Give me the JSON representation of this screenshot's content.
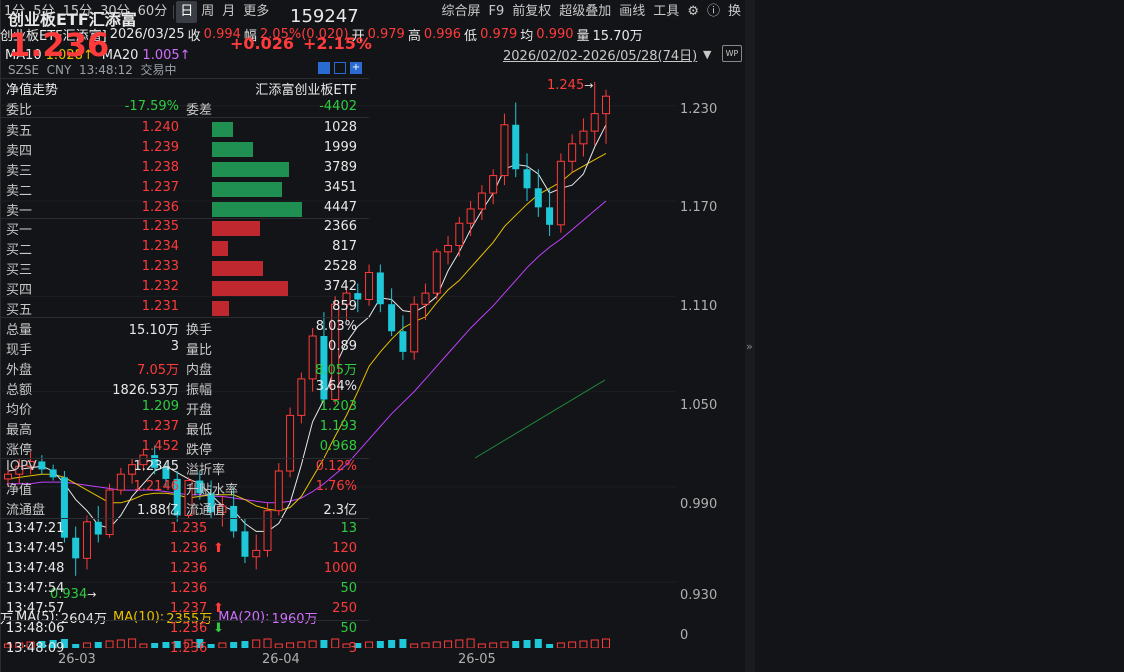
{
  "toolbar": {
    "periods": [
      "1分",
      "5分",
      "15分",
      "30分",
      "60分",
      "日",
      "周",
      "月",
      "更多"
    ],
    "active": "日",
    "tools": [
      "综合屏",
      "F9",
      "前复权",
      "超级叠加",
      "画线",
      "工具"
    ],
    "last": "换"
  },
  "info": {
    "name": "创业板ETF汇添富]",
    "date": "2026/03/25",
    "close_label": "收",
    "close": "0.994",
    "range_label": "幅",
    "range": "2.05%(0.020)",
    "open_label": "开",
    "open": "0.979",
    "high_label": "高",
    "high": "0.996",
    "low_label": "低",
    "low": "0.979",
    "avg_label": "均",
    "avg": "0.990",
    "vol_label": "量",
    "vol": "15.70万"
  },
  "ma": {
    "ma10_label": "MA10",
    "ma10": "1.028↑",
    "ma20_label": "MA20",
    "ma20": "1.005↑"
  },
  "daterange": "2026/02/02-2026/05/28(74日)",
  "axis": {
    "ticks": [
      "1.230",
      "1.170",
      "1.110",
      "1.050",
      "0.990",
      "0.930"
    ],
    "vol_tick": "0"
  },
  "annot": {
    "high": "1.245",
    "low": "0.934"
  },
  "vol_info": {
    "unit": "万",
    "ma5_label": "MA(5):",
    "ma5": "2604万",
    "ma10_label": "MA(10):",
    "ma10": "2355万",
    "ma20_label": "MA(20):",
    "ma20": "1960万"
  },
  "xlabels": [
    "26-03",
    "26-04",
    "26-05"
  ],
  "chart_data": {
    "type": "candlestick",
    "ylim": [
      0.915,
      1.255
    ],
    "candles": [
      [
        0.995,
        1.005,
        0.99,
        0.998
      ],
      [
        0.998,
        1.008,
        0.992,
        1.003
      ],
      [
        1.003,
        1.012,
        0.998,
        1.006
      ],
      [
        1.006,
        1.01,
        0.998,
        1.001
      ],
      [
        1.001,
        1.004,
        0.994,
        0.996
      ],
      [
        0.996,
        1.0,
        0.955,
        0.958
      ],
      [
        0.958,
        0.965,
        0.934,
        0.945
      ],
      [
        0.945,
        0.972,
        0.938,
        0.968
      ],
      [
        0.968,
        0.978,
        0.955,
        0.96
      ],
      [
        0.96,
        0.992,
        0.958,
        0.988
      ],
      [
        0.988,
        1.002,
        0.985,
        0.998
      ],
      [
        0.998,
        1.008,
        0.992,
        1.004
      ],
      [
        1.004,
        1.014,
        1.0,
        1.01
      ],
      [
        1.01,
        1.016,
        0.998,
        1.002
      ],
      [
        1.002,
        1.006,
        0.99,
        0.995
      ],
      [
        0.995,
        1.0,
        0.968,
        0.972
      ],
      [
        0.972,
        0.996,
        0.97,
        0.994
      ],
      [
        0.994,
        1.0,
        0.982,
        0.986
      ],
      [
        0.986,
        0.994,
        0.97,
        0.974
      ],
      [
        0.974,
        0.984,
        0.965,
        0.978
      ],
      [
        0.978,
        0.99,
        0.958,
        0.962
      ],
      [
        0.962,
        0.97,
        0.942,
        0.946
      ],
      [
        0.946,
        0.96,
        0.938,
        0.95
      ],
      [
        0.95,
        0.98,
        0.946,
        0.975
      ],
      [
        0.975,
        1.005,
        0.972,
        1.0
      ],
      [
        1.0,
        1.04,
        0.996,
        1.035
      ],
      [
        1.035,
        1.062,
        1.03,
        1.058
      ],
      [
        1.058,
        1.09,
        1.05,
        1.085
      ],
      [
        1.085,
        1.1,
        1.04,
        1.045
      ],
      [
        1.045,
        1.11,
        1.042,
        1.105
      ],
      [
        1.105,
        1.115,
        1.095,
        1.112
      ],
      [
        1.112,
        1.118,
        1.1,
        1.108
      ],
      [
        1.108,
        1.13,
        1.104,
        1.125
      ],
      [
        1.125,
        1.13,
        1.1,
        1.105
      ],
      [
        1.105,
        1.115,
        1.085,
        1.088
      ],
      [
        1.088,
        1.098,
        1.07,
        1.075
      ],
      [
        1.075,
        1.11,
        1.07,
        1.105
      ],
      [
        1.105,
        1.118,
        1.095,
        1.112
      ],
      [
        1.112,
        1.14,
        1.108,
        1.138
      ],
      [
        1.138,
        1.148,
        1.13,
        1.142
      ],
      [
        1.142,
        1.16,
        1.135,
        1.156
      ],
      [
        1.156,
        1.17,
        1.148,
        1.165
      ],
      [
        1.165,
        1.18,
        1.158,
        1.175
      ],
      [
        1.175,
        1.19,
        1.168,
        1.186
      ],
      [
        1.186,
        1.225,
        1.18,
        1.218
      ],
      [
        1.218,
        1.232,
        1.185,
        1.19
      ],
      [
        1.19,
        1.2,
        1.17,
        1.178
      ],
      [
        1.178,
        1.19,
        1.16,
        1.166
      ],
      [
        1.166,
        1.178,
        1.148,
        1.155
      ],
      [
        1.155,
        1.2,
        1.15,
        1.195
      ],
      [
        1.195,
        1.212,
        1.188,
        1.206
      ],
      [
        1.206,
        1.222,
        1.198,
        1.214
      ],
      [
        1.214,
        1.245,
        1.205,
        1.225
      ],
      [
        1.225,
        1.24,
        1.206,
        1.236
      ]
    ],
    "ma5": [
      1.0,
      1.001,
      1.002,
      1.003,
      1.0,
      0.992,
      0.982,
      0.975,
      0.966,
      0.964,
      0.972,
      0.984,
      0.992,
      1.0,
      1.003,
      0.999,
      0.995,
      0.992,
      0.985,
      0.978,
      0.975,
      0.967,
      0.962,
      0.962,
      0.967,
      0.98,
      1.004,
      1.031,
      1.045,
      1.066,
      1.081,
      1.091,
      1.097,
      1.109,
      1.108,
      1.101,
      1.1,
      1.104,
      1.11,
      1.126,
      1.138,
      1.152,
      1.164,
      1.175,
      1.19,
      1.193,
      1.192,
      1.187,
      1.175,
      1.178,
      1.18,
      1.187,
      1.204,
      1.218
    ],
    "ma10": [
      0.995,
      0.996,
      0.997,
      0.998,
      0.998,
      0.996,
      0.992,
      0.988,
      0.984,
      0.98,
      0.98,
      0.982,
      0.985,
      0.986,
      0.986,
      0.985,
      0.983,
      0.984,
      0.985,
      0.985,
      0.985,
      0.982,
      0.978,
      0.976,
      0.975,
      0.977,
      0.984,
      0.996,
      1.008,
      1.022,
      1.035,
      1.05,
      1.066,
      1.075,
      1.083,
      1.09,
      1.094,
      1.097,
      1.106,
      1.114,
      1.12,
      1.128,
      1.136,
      1.144,
      1.154,
      1.161,
      1.168,
      1.174,
      1.178,
      1.182,
      1.188,
      1.192,
      1.196,
      1.2
    ],
    "ma20": [
      0.992,
      0.992,
      0.992,
      0.993,
      0.993,
      0.993,
      0.992,
      0.991,
      0.99,
      0.989,
      0.988,
      0.988,
      0.988,
      0.988,
      0.987,
      0.986,
      0.985,
      0.985,
      0.984,
      0.984,
      0.983,
      0.982,
      0.981,
      0.98,
      0.98,
      0.981,
      0.983,
      0.987,
      0.992,
      0.998,
      1.004,
      1.012,
      1.02,
      1.028,
      1.036,
      1.043,
      1.05,
      1.058,
      1.066,
      1.074,
      1.082,
      1.09,
      1.097,
      1.104,
      1.112,
      1.12,
      1.128,
      1.135,
      1.141,
      1.146,
      1.152,
      1.158,
      1.164,
      1.17
    ],
    "extra_line": [
      [
        475,
        458
      ],
      [
        605,
        380
      ]
    ]
  },
  "quote": {
    "name": "创业板ETF汇添富",
    "code": "159247",
    "price": "1.236",
    "change": "+0.026",
    "pct": "+2.15%",
    "meta": "SZSE  CNY  13:48:12  交易中",
    "nav_label": "净值走势",
    "nav_name": "汇添富创业板ETF",
    "wb_label": "委比",
    "wb": "-17.59%",
    "wc_label": "委差",
    "wc": "-4402"
  },
  "sells": [
    {
      "label": "卖五",
      "price": "1.240",
      "vol": "1028",
      "ratio": 0.23
    },
    {
      "label": "卖四",
      "price": "1.239",
      "vol": "1999",
      "ratio": 0.45
    },
    {
      "label": "卖三",
      "price": "1.238",
      "vol": "3789",
      "ratio": 0.85
    },
    {
      "label": "卖二",
      "price": "1.237",
      "vol": "3451",
      "ratio": 0.78
    },
    {
      "label": "卖一",
      "price": "1.236",
      "vol": "4447",
      "ratio": 1.0
    }
  ],
  "buys": [
    {
      "label": "买一",
      "price": "1.235",
      "vol": "2366",
      "ratio": 0.53
    },
    {
      "label": "买二",
      "price": "1.234",
      "vol": "817",
      "ratio": 0.18
    },
    {
      "label": "买三",
      "price": "1.233",
      "vol": "2528",
      "ratio": 0.57
    },
    {
      "label": "买四",
      "price": "1.232",
      "vol": "3742",
      "ratio": 0.84
    },
    {
      "label": "买五",
      "price": "1.231",
      "vol": "859",
      "ratio": 0.19
    }
  ],
  "stats": [
    {
      "l1": "总量",
      "v1": "15.10万",
      "c1": "white",
      "l2": "换手",
      "v2": "8.03%",
      "c2": "white"
    },
    {
      "l1": "现手",
      "v1": "3",
      "c1": "white",
      "l2": "量比",
      "v2": "0.89",
      "c2": "white"
    },
    {
      "l1": "外盘",
      "v1": "7.05万",
      "c1": "red",
      "l2": "内盘",
      "v2": "8.05万",
      "c2": "green"
    },
    {
      "l1": "总额",
      "v1": "1826.53万",
      "c1": "white",
      "l2": "振幅",
      "v2": "3.64%",
      "c2": "white"
    },
    {
      "l1": "均价",
      "v1": "1.209",
      "c1": "green",
      "l2": "开盘",
      "v2": "1.203",
      "c2": "green"
    },
    {
      "l1": "最高",
      "v1": "1.237",
      "c1": "red",
      "l2": "最低",
      "v2": "1.193",
      "c2": "green"
    },
    {
      "l1": "涨停",
      "v1": "1.452",
      "c1": "red",
      "l2": "跌停",
      "v2": "0.968",
      "c2": "green"
    },
    {
      "l1": "IOPV",
      "v1": "1.2345",
      "c1": "white",
      "l2": "溢折率",
      "v2": "0.12%",
      "c2": "red"
    },
    {
      "l1": "净值",
      "v1": "1.2146",
      "c1": "red",
      "l2": "升贴水率",
      "v2": "1.76%",
      "c2": "red"
    },
    {
      "l1": "流通盘",
      "v1": "1.88亿",
      "c1": "white",
      "l2": "流通值",
      "v2": "2.3亿",
      "c2": "white"
    }
  ],
  "ticks": [
    {
      "time": "13:47:21",
      "price": "1.235",
      "arrow": "",
      "vol": "13",
      "color": "green"
    },
    {
      "time": "13:47:45",
      "price": "1.236",
      "arrow": "up",
      "vol": "120",
      "color": "red"
    },
    {
      "time": "13:47:48",
      "price": "1.236",
      "arrow": "",
      "vol": "1000",
      "color": "red"
    },
    {
      "time": "13:47:54",
      "price": "1.236",
      "arrow": "",
      "vol": "50",
      "color": "green"
    },
    {
      "time": "13:47:57",
      "price": "1.237",
      "arrow": "up",
      "vol": "250",
      "color": "red"
    },
    {
      "time": "13:48:06",
      "price": "1.236",
      "arrow": "down",
      "vol": "50",
      "color": "green"
    },
    {
      "time": "13:48:09",
      "price": "1.236",
      "arrow": "",
      "vol": "3",
      "color": "red"
    }
  ],
  "colors": {
    "up": "#ff3b3b",
    "down": "#1ec8d8",
    "ma5": "#e8e8e8",
    "ma10": "#e8c000",
    "ma20": "#c040ff",
    "extra": "#1f8a3a",
    "buybar": "#c0282f",
    "sellbar": "#1f8f52"
  }
}
